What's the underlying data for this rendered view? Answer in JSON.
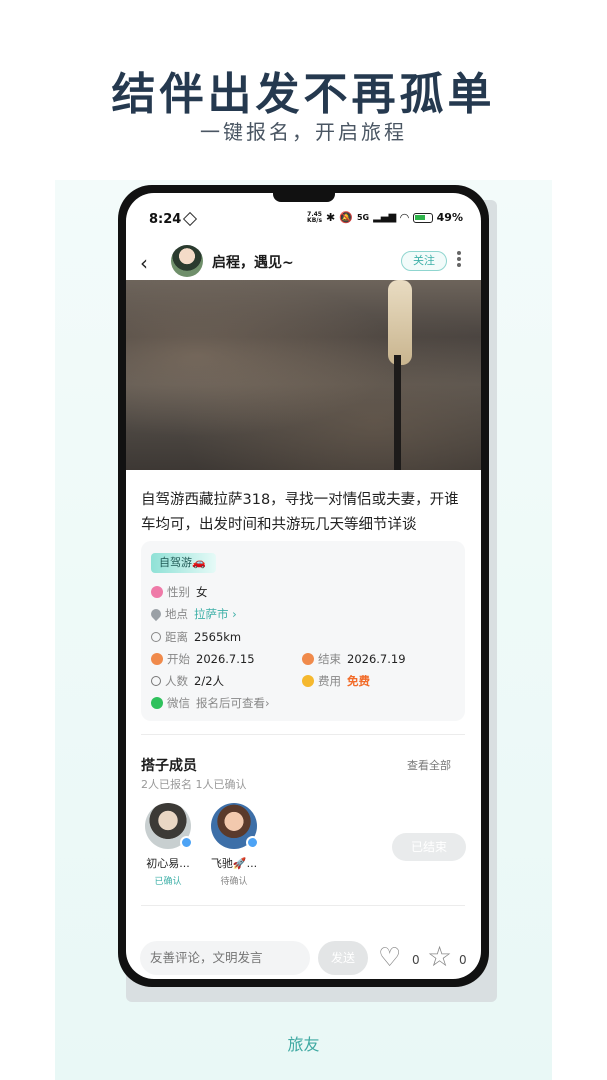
{
  "promo": {
    "headline": "结伴出发不再孤单",
    "subline": "一键报名，开启旅程",
    "footer_label": "旅友"
  },
  "status_bar": {
    "time": "8:24",
    "net_speed_value": "7.45",
    "net_speed_unit": "KB/s",
    "signal": "5G",
    "battery": "49%"
  },
  "nav": {
    "title": "启程，遇见~",
    "follow_label": "关注"
  },
  "post": {
    "text": "自驾游西藏拉萨318，寻找一对情侣或夫妻，开谁车均可，出发时间和共游玩几天等细节详谈",
    "type_tag": "自驾游🚗",
    "gender_label": "性别",
    "gender_value": "女",
    "location_label": "地点",
    "location_value": "拉萨市 ›",
    "distance_label": "距离",
    "distance_value": "2565km",
    "start_label": "开始",
    "start_value": "2026.7.15",
    "end_label": "结束",
    "end_value": "2026.7.19",
    "people_label": "人数",
    "people_value": "2/2人",
    "fee_label": "费用",
    "fee_value": "免费",
    "wechat_label": "微信",
    "wechat_value": "报名后可查看›"
  },
  "members": {
    "title": "搭子成员",
    "count_text": "2人已报名 1人已确认",
    "view_all": "查看全部",
    "items": [
      {
        "name": "初心易...",
        "status": "已确认",
        "status_color": "#3fb0a8"
      },
      {
        "name": "飞驰🚀...",
        "status": "待确认",
        "status_color": "#888888"
      }
    ],
    "ended_label": "已结束"
  },
  "comment": {
    "placeholder": "友善评论，文明发言",
    "send_label": "发送",
    "like_count": "0",
    "star_count": "0"
  }
}
